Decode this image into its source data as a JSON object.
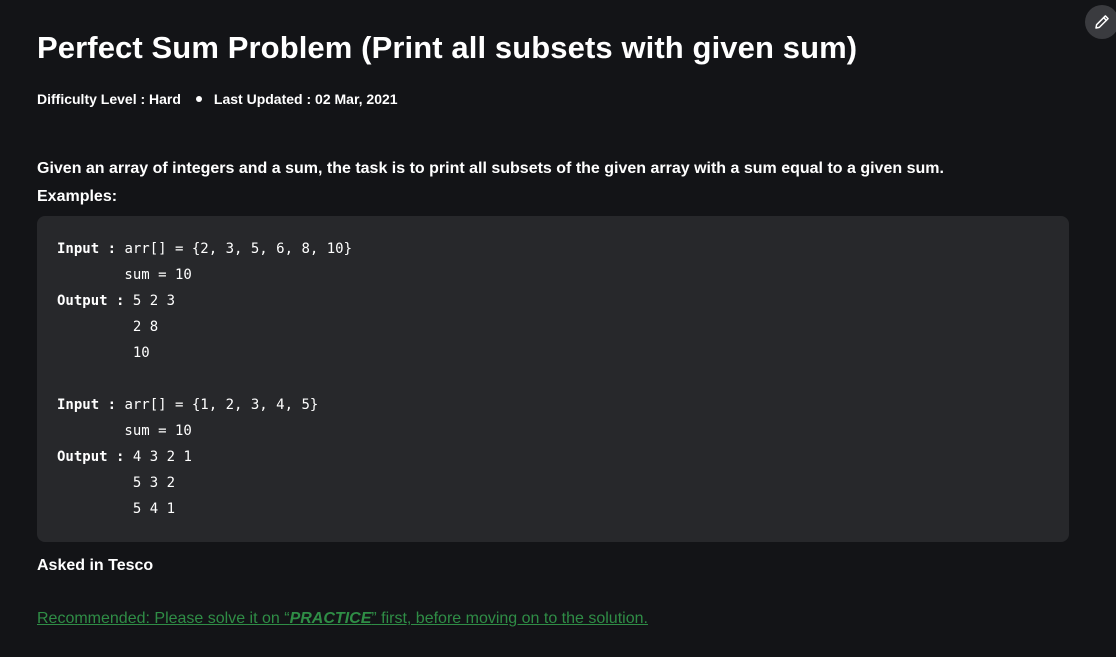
{
  "article": {
    "title": "Perfect Sum Problem (Print all subsets with given sum)",
    "difficulty": "Difficulty Level : Hard",
    "last_updated": "Last Updated : 02 Mar, 2021",
    "description": "Given an array of integers and a sum, the task is to print all subsets of the given array with a sum equal to a given sum.",
    "examples_label": "Examples:",
    "asked_in": "Asked in Tesco"
  },
  "code_lines": [
    {
      "kw": "Input :",
      "rest": " arr[] = {2, 3, 5, 6, 8, 10}"
    },
    {
      "kw": "",
      "rest": "        sum = 10"
    },
    {
      "kw": "Output :",
      "rest": " 5 2 3"
    },
    {
      "kw": "",
      "rest": "         2 8"
    },
    {
      "kw": "",
      "rest": "         10"
    },
    {
      "kw": "",
      "rest": ""
    },
    {
      "kw": "Input :",
      "rest": " arr[] = {1, 2, 3, 4, 5}"
    },
    {
      "kw": "",
      "rest": "        sum = 10"
    },
    {
      "kw": "Output :",
      "rest": " 4 3 2 1"
    },
    {
      "kw": "",
      "rest": "         5 3 2"
    },
    {
      "kw": "",
      "rest": "         5 4 1"
    }
  ],
  "recommendation": {
    "prefix": "Recommended: Please solve it on “",
    "practice": "PRACTICE",
    "suffix": "” first, before moving on to the solution."
  },
  "toolbar": {
    "edit_icon": "pencil-icon"
  },
  "colors": {
    "background": "#131417",
    "code_background": "#27282b",
    "link_green": "#2f8d46"
  }
}
